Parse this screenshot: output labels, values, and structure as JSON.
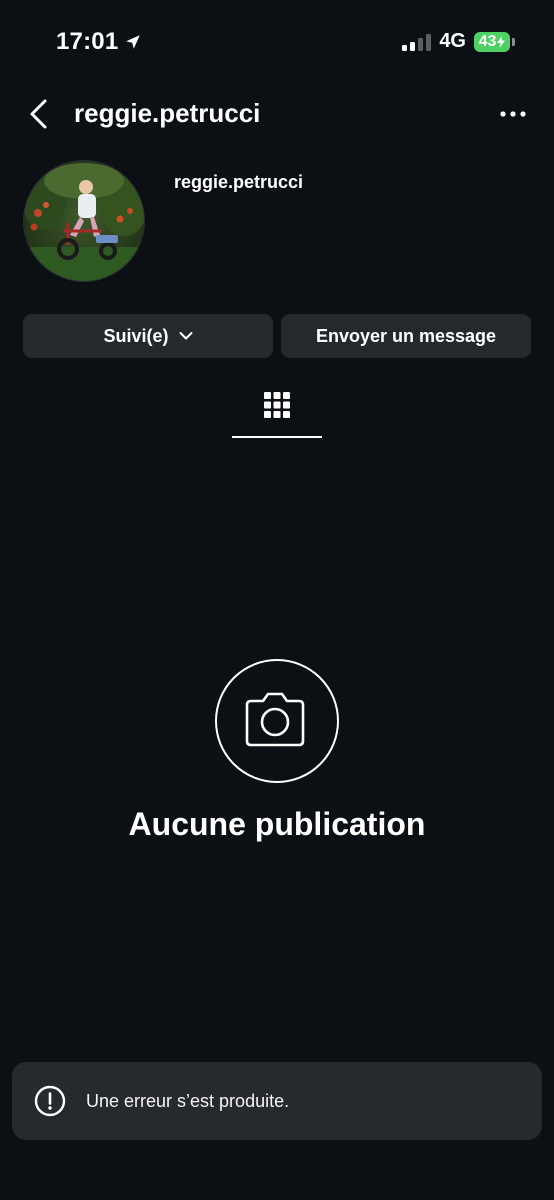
{
  "status_bar": {
    "time": "17:01",
    "network": "4G",
    "battery": "43",
    "battery_color": "#4ed164"
  },
  "header": {
    "title": "reggie.petrucci",
    "back_icon": "chevron-left-icon",
    "more_icon": "more-horizontal-icon"
  },
  "profile": {
    "username": "reggie.petrucci",
    "avatar_desc": "avatar"
  },
  "actions": {
    "follow_label": "Suivi(e)",
    "message_label": "Envoyer un message"
  },
  "tabs": {
    "active": "grid-icon"
  },
  "empty_state": {
    "icon": "camera-icon",
    "title": "Aucune publication"
  },
  "toast": {
    "icon": "alert-circle-icon",
    "message": "Une erreur s’est produite."
  },
  "colors": {
    "background": "#0c1014",
    "button_bg": "#25292e",
    "toast_bg": "#262a2f",
    "text": "#ffffff"
  }
}
